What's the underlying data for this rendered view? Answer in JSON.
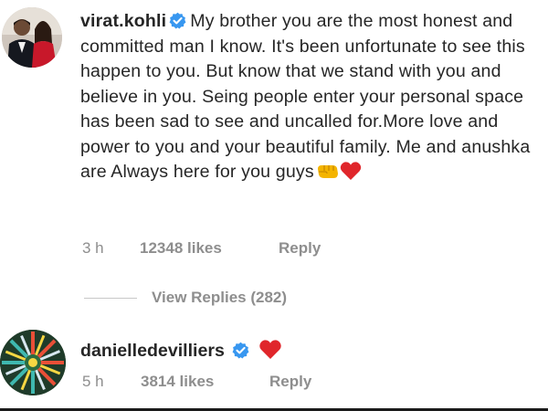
{
  "comments": [
    {
      "username": "virat.kohli",
      "verified": true,
      "avatar_icon": "couple-photo-avatar",
      "text": "My brother you are the most honest and committed man I know. It's been unfortunate to see this happen to you. But know that we stand with you and believe in you. Seing people enter your personal space has been sad to see and uncalled for.More love and power to you and your beautiful family. Me and anushka are Always here for you guys",
      "trailing_emojis": [
        "fist-bump-icon",
        "red-heart-icon"
      ],
      "time": "3 h",
      "likes": "12348 likes",
      "reply_label": "Reply",
      "view_replies_label": "View Replies (282)"
    },
    {
      "username": "danielledevilliers",
      "verified": true,
      "avatar_icon": "colorful-mandala-avatar",
      "trailing_emojis": [
        "red-heart-icon"
      ],
      "time": "5 h",
      "likes": "3814 likes",
      "reply_label": "Reply"
    }
  ],
  "colors": {
    "text": "#262626",
    "muted": "#8e8e8e",
    "verified_blue": "#3897f0",
    "heart_red": "#e0262b",
    "fist_yellow": "#f4b400"
  }
}
